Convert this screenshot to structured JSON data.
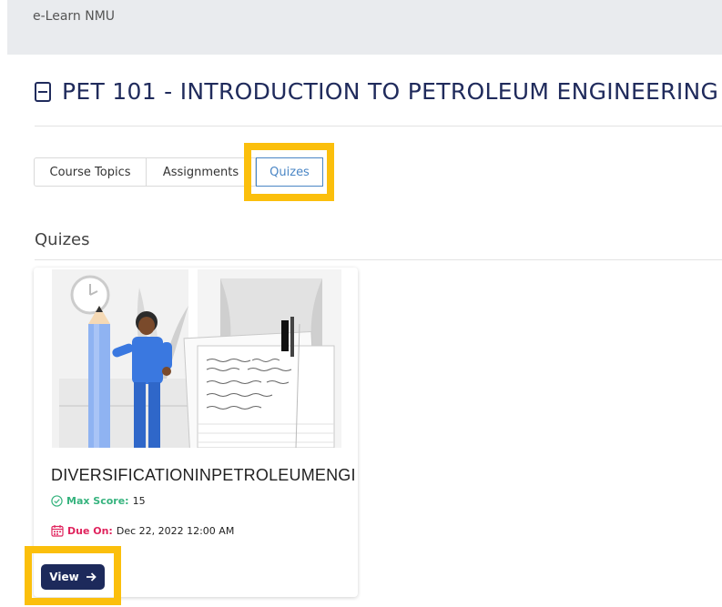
{
  "header": {
    "brand": "e-Learn NMU"
  },
  "course": {
    "title": "PET 101 - INTRODUCTION TO PETROLEUM ENGINEERING"
  },
  "tabs": [
    {
      "label": "Course Topics",
      "active": false
    },
    {
      "label": "Assignments",
      "active": false
    },
    {
      "label": "Quizes",
      "active": true
    }
  ],
  "section": {
    "title": "Quizes"
  },
  "quiz_card": {
    "name": "DIVERSIFICATIONINPETROLEUMENGINEERING",
    "max_score_label": "Max Score:",
    "max_score_value": "15",
    "due_label": "Due On:",
    "due_value": "Dec 22, 2022 12:00 AM",
    "view_label": "View",
    "illustration": "person-with-pencil-and-document"
  },
  "colors": {
    "navy": "#1d2a5b",
    "highlight": "#fbbf0c",
    "active_tab": "#4a86c5",
    "score_green": "#36b37e",
    "due_red": "#e0245e"
  }
}
